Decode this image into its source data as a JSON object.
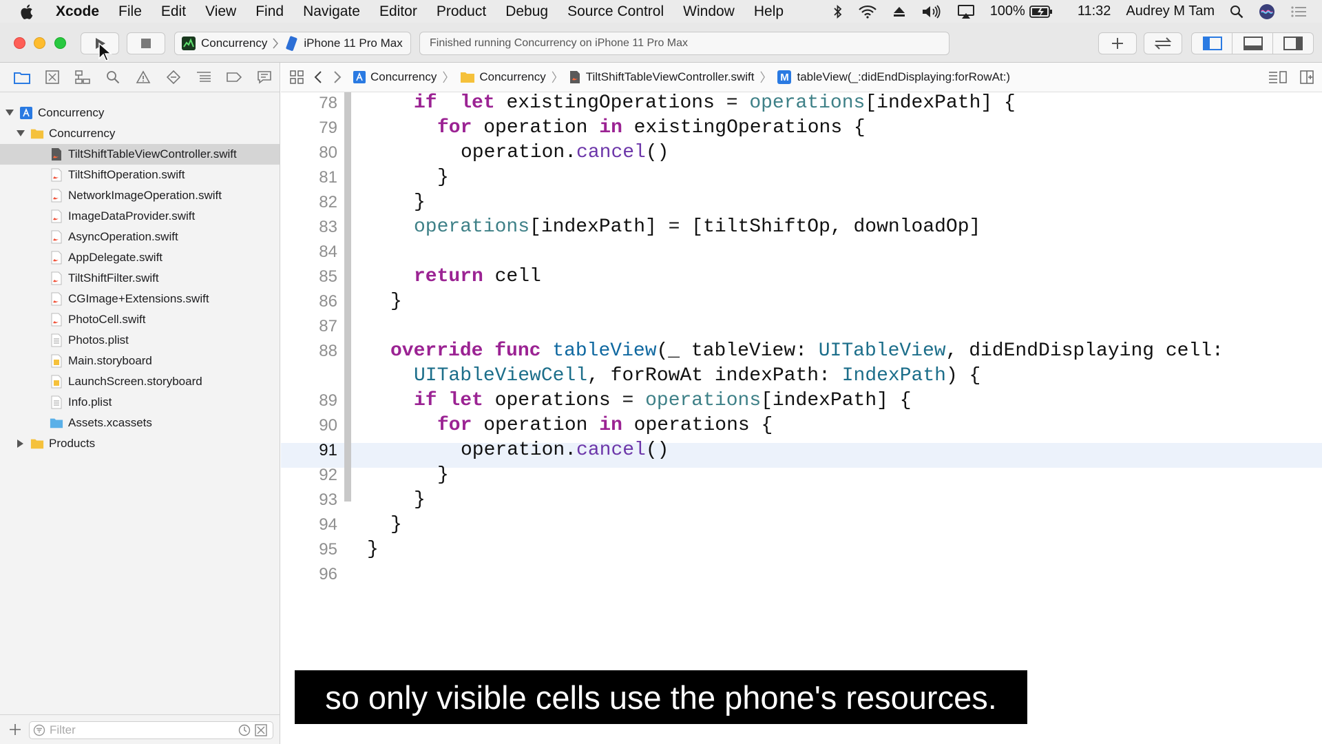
{
  "menubar": {
    "app": "Xcode",
    "items": [
      "File",
      "Edit",
      "View",
      "Find",
      "Navigate",
      "Editor",
      "Product",
      "Debug",
      "Source Control",
      "Window",
      "Help"
    ],
    "battery": "100%",
    "time": "11:32",
    "user": "Audrey M Tam"
  },
  "toolbar": {
    "scheme": "Concurrency",
    "destination": "iPhone 11 Pro Max",
    "activity": "Finished running Concurrency on iPhone 11 Pro Max"
  },
  "navigator": {
    "tree": [
      {
        "label": "Concurrency",
        "level": 0,
        "kind": "project",
        "disclosure": "open"
      },
      {
        "label": "Concurrency",
        "level": 1,
        "kind": "folder",
        "disclosure": "open"
      },
      {
        "label": "TiltShiftTableViewController.swift",
        "level": 2,
        "kind": "swift",
        "selected": true
      },
      {
        "label": "TiltShiftOperation.swift",
        "level": 2,
        "kind": "swift"
      },
      {
        "label": "NetworkImageOperation.swift",
        "level": 2,
        "kind": "swift"
      },
      {
        "label": "ImageDataProvider.swift",
        "level": 2,
        "kind": "swift"
      },
      {
        "label": "AsyncOperation.swift",
        "level": 2,
        "kind": "swift"
      },
      {
        "label": "AppDelegate.swift",
        "level": 2,
        "kind": "swift"
      },
      {
        "label": "TiltShiftFilter.swift",
        "level": 2,
        "kind": "swift"
      },
      {
        "label": "CGImage+Extensions.swift",
        "level": 2,
        "kind": "swift"
      },
      {
        "label": "PhotoCell.swift",
        "level": 2,
        "kind": "swift"
      },
      {
        "label": "Photos.plist",
        "level": 2,
        "kind": "plist"
      },
      {
        "label": "Main.storyboard",
        "level": 2,
        "kind": "storyboard"
      },
      {
        "label": "LaunchScreen.storyboard",
        "level": 2,
        "kind": "storyboard"
      },
      {
        "label": "Info.plist",
        "level": 2,
        "kind": "plist"
      },
      {
        "label": "Assets.xcassets",
        "level": 2,
        "kind": "assets"
      },
      {
        "label": "Products",
        "level": 1,
        "kind": "folder",
        "disclosure": "closed"
      }
    ],
    "filter_placeholder": "Filter"
  },
  "jumpbar": {
    "project": "Concurrency",
    "group": "Concurrency",
    "file": "TiltShiftTableViewController.swift",
    "method_badge": "M",
    "method": "tableView(_:didEndDisplaying:forRowAt:)"
  },
  "editor": {
    "current_line": "91",
    "lines": [
      {
        "n": "78",
        "indent": 2,
        "tokens": [
          [
            "kw",
            "if"
          ],
          [
            "",
            "  "
          ],
          [
            "kw",
            "let"
          ],
          [
            "",
            " existingOperations = "
          ],
          [
            "pr",
            "operations"
          ],
          [
            "",
            "[indexPath] {"
          ]
        ]
      },
      {
        "n": "79",
        "indent": 3,
        "tokens": [
          [
            "kw",
            "for"
          ],
          [
            "",
            " operation "
          ],
          [
            "kw",
            "in"
          ],
          [
            "",
            " existingOperations {"
          ]
        ]
      },
      {
        "n": "80",
        "indent": 4,
        "tokens": [
          [
            "",
            "operation."
          ],
          [
            "mt",
            "cancel"
          ],
          [
            "",
            "()"
          ]
        ]
      },
      {
        "n": "81",
        "indent": 3,
        "tokens": [
          [
            "",
            "}"
          ]
        ]
      },
      {
        "n": "82",
        "indent": 2,
        "tokens": [
          [
            "",
            "}"
          ]
        ]
      },
      {
        "n": "83",
        "indent": 2,
        "tokens": [
          [
            "pr",
            "operations"
          ],
          [
            "",
            "[indexPath] = [tiltShiftOp, downloadOp]"
          ]
        ]
      },
      {
        "n": "84",
        "indent": 2,
        "tokens": []
      },
      {
        "n": "85",
        "indent": 2,
        "tokens": [
          [
            "kw",
            "return"
          ],
          [
            "",
            " cell"
          ]
        ]
      },
      {
        "n": "86",
        "indent": 1,
        "tokens": [
          [
            "",
            "}"
          ]
        ]
      },
      {
        "n": "87",
        "indent": 1,
        "tokens": []
      },
      {
        "n": "88",
        "indent": 1,
        "tokens": [
          [
            "kw",
            "override"
          ],
          [
            "",
            " "
          ],
          [
            "kw",
            "func"
          ],
          [
            "",
            " "
          ],
          [
            "fn",
            "tableView"
          ],
          [
            "",
            "(_ tableView: "
          ],
          [
            "ty",
            "UITableView"
          ],
          [
            "",
            ", didEndDisplaying cell:"
          ]
        ]
      },
      {
        "n": "",
        "indent": 2,
        "tokens": [
          [
            "ty",
            "UITableViewCell"
          ],
          [
            "",
            ", forRowAt indexPath: "
          ],
          [
            "ty",
            "IndexPath"
          ],
          [
            "",
            ") {"
          ]
        ]
      },
      {
        "n": "89",
        "indent": 2,
        "tokens": [
          [
            "kw",
            "if"
          ],
          [
            "",
            " "
          ],
          [
            "kw",
            "let"
          ],
          [
            "",
            " operations = "
          ],
          [
            "pr",
            "operations"
          ],
          [
            "",
            "[indexPath] {"
          ]
        ]
      },
      {
        "n": "90",
        "indent": 3,
        "tokens": [
          [
            "kw",
            "for"
          ],
          [
            "",
            " operation "
          ],
          [
            "kw",
            "in"
          ],
          [
            "",
            " operations {"
          ]
        ]
      },
      {
        "n": "91",
        "indent": 4,
        "tokens": [
          [
            "",
            "operation."
          ],
          [
            "mt",
            "cancel"
          ],
          [
            "",
            "()"
          ]
        ]
      },
      {
        "n": "92",
        "indent": 3,
        "tokens": [
          [
            "",
            "}"
          ]
        ]
      },
      {
        "n": "93",
        "indent": 2,
        "tokens": [
          [
            "",
            "}"
          ]
        ]
      },
      {
        "n": "94",
        "indent": 1,
        "tokens": [
          [
            "",
            "}"
          ]
        ]
      },
      {
        "n": "95",
        "indent": 0,
        "tokens": [
          [
            "",
            "}"
          ]
        ]
      },
      {
        "n": "96",
        "indent": 0,
        "tokens": []
      }
    ]
  },
  "caption": "so only visible cells use the phone's resources.",
  "colors": {
    "keyword": "#9b2393",
    "property": "#3e8087",
    "function": "#0f68a0",
    "type": "#1c6e8a",
    "method": "#6c36a9",
    "accent": "#2a7ae2"
  }
}
